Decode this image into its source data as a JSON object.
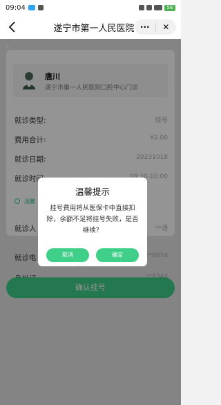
{
  "status_bar": {
    "time": "09:04",
    "battery": "56"
  },
  "nav": {
    "title": "遂宁市第一人民医院",
    "more_label": "···",
    "close_label": "✕"
  },
  "patient": {
    "name": "唐川",
    "department": "遂宁市第一人民医院口腔中心门诊"
  },
  "details": [
    {
      "label": "就诊类型:",
      "value": "挂号"
    },
    {
      "label": "费用合计:",
      "value": "¥2.00"
    },
    {
      "label": "就诊日期:",
      "value": "20231018"
    },
    {
      "label": "就诊时间:",
      "value": "09:30-10:00"
    }
  ],
  "notice": "温馨",
  "details_lower": [
    {
      "label": "就诊人",
      "value": "**语"
    },
    {
      "label": "就诊电",
      "value": "**6674"
    },
    {
      "label": "身份证",
      "value": "**9344"
    }
  ],
  "confirm_label": "确认挂号",
  "dialog": {
    "title": "温馨提示",
    "body": "挂号费用将从医保卡中直接扣除，余额不足将挂号失败，是否继续？",
    "cancel_label": "取消",
    "ok_label": "确定"
  },
  "colors": {
    "accent": "#3fcf89",
    "notice": "#38c68a"
  }
}
